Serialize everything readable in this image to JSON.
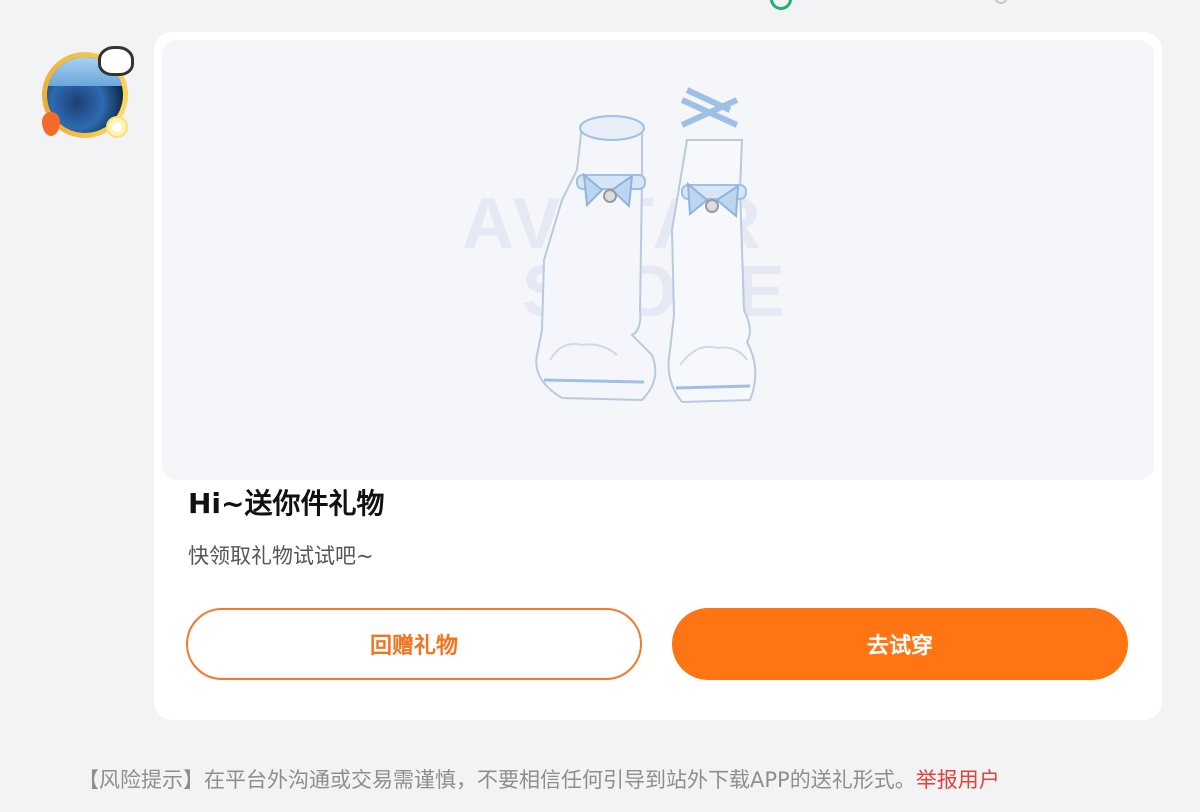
{
  "gift_card": {
    "title": "Hi~送你件礼物",
    "subtitle": "快领取礼物试试吧~",
    "watermark_line1": "AVATAR",
    "watermark_line2": "STORE",
    "return_gift_label": "回赠礼物",
    "try_on_label": "去试穿"
  },
  "footer": {
    "risk_text": "【风险提示】在平台外沟通或交易需谨慎，不要相信任何引导到站外下载APP的送礼形式。",
    "report_label": "举报用户"
  },
  "colors": {
    "accent_orange": "#ff7413",
    "report_red": "#e5403a",
    "online_green": "#1cb36b"
  },
  "icons": {
    "avatar": "user-avatar",
    "gift": "boots-gift-image"
  }
}
